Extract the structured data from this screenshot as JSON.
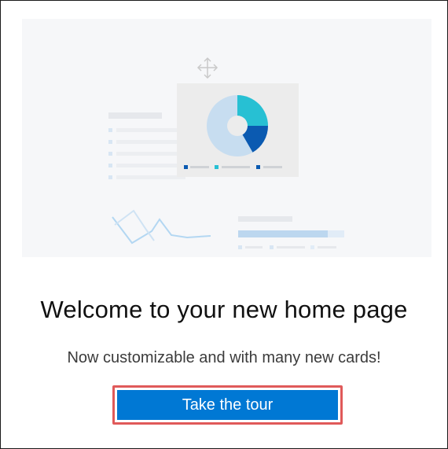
{
  "dialog": {
    "title": "Welcome to your new home page",
    "subtitle": "Now customizable and with many new cards!",
    "cta_label": "Take the tour"
  },
  "illustration": {
    "icon": "move-arrows-icon",
    "colors": {
      "background": "#f6f7f9",
      "card": "#ececec",
      "teal": "#27c0d3",
      "dark_blue": "#0b5ab1",
      "light_blue": "#c7ddf0",
      "bar_light": "#bcd7ef",
      "line": "#b3d7f2"
    }
  },
  "colors": {
    "primary_button": "#0078d4",
    "highlight_outline": "#e05a5a"
  }
}
